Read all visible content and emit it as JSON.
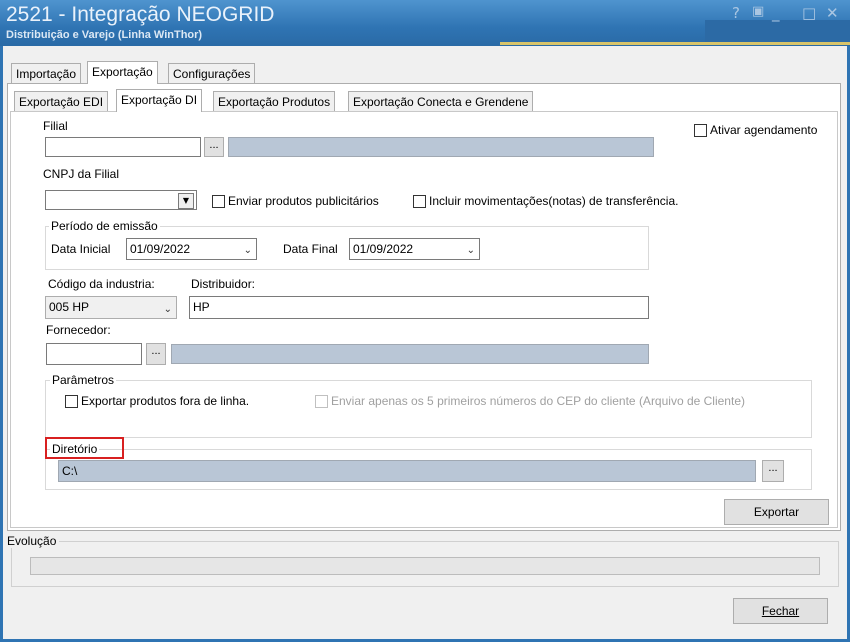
{
  "window": {
    "title": "2521 - Integração NEOGRID",
    "subtitle": "Distribuição e Varejo (Linha WinThor)",
    "controls": [
      "?",
      "restore-icon",
      "minimize-icon",
      "maximize-icon",
      "close-icon"
    ]
  },
  "main_tabs": [
    "Importação",
    "Exportação",
    "Configurações"
  ],
  "sub_tabs": [
    "Exportação EDI",
    "Exportação DI",
    "Exportação Produtos",
    "Exportação Conecta e Grendene"
  ],
  "form": {
    "filial_label": "Filial",
    "filial_value": "",
    "browse_label": "...",
    "ativar_agendamento": "Ativar agendamento",
    "cnpj_label": "CNPJ da Filial",
    "enviar_publicitarios": "Enviar produtos publicitários",
    "incluir_movimentacoes": "Incluir movimentações(notas) de transferência.",
    "periodo_label": "Período de emissão",
    "data_inicial_label": "Data Inicial",
    "data_inicial": "01/09/2022",
    "data_final_label": "Data Final",
    "data_final": "01/09/2022",
    "codigo_industria_label": "Código da industria:",
    "codigo_industria_value": "005 HP",
    "distribuidor_label": "Distribuidor:",
    "distribuidor_value": "HP",
    "fornecedor_label": "Fornecedor:",
    "parametros_label": "Parâmetros",
    "exportar_fora_linha": "Exportar produtos fora de linha.",
    "enviar_cep": "Enviar apenas os 5 primeiros números do CEP do cliente (Arquivo de Cliente)",
    "diretorio_label": "Diretório",
    "diretorio_value": "C:\\",
    "exportar_button": "Exportar"
  },
  "evolucao_label": "Evolução",
  "fechar_button": "Fechar",
  "colors": {
    "title_bg": "#2f74b3",
    "highlight": "#d82020",
    "gray_field": "#b9c6d6"
  }
}
